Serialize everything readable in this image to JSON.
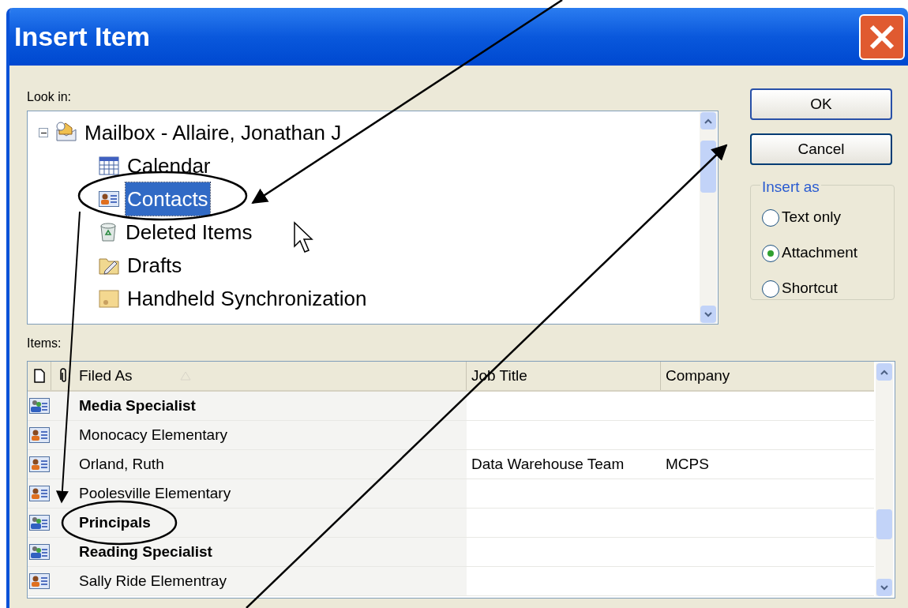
{
  "window": {
    "title": "Insert Item"
  },
  "look_in": {
    "label": "Look in:",
    "tree": {
      "label": "Mailbox - Allaire, Jonathan J",
      "expanded": true,
      "children": [
        {
          "label": "Calendar",
          "selected": false
        },
        {
          "label": "Contacts",
          "selected": true
        },
        {
          "label": "Deleted Items",
          "selected": false
        },
        {
          "label": "Drafts",
          "selected": false
        },
        {
          "label": "Handheld Synchronization",
          "selected": false
        }
      ]
    }
  },
  "buttons": [
    "OK",
    "Cancel"
  ],
  "insert_as": {
    "label": "Insert as",
    "options": [
      {
        "label": "Text only",
        "selected": false
      },
      {
        "label": "Attachment",
        "selected": true
      },
      {
        "label": "Shortcut",
        "selected": false
      }
    ]
  },
  "items": {
    "label": "Items:",
    "columns": [
      "Filed As",
      "Job Title",
      "Company"
    ],
    "rows": [
      {
        "kind": "group",
        "filed_as": "Media Specialist"
      },
      {
        "kind": "contact",
        "filed_as": "Monocacy Elementary"
      },
      {
        "kind": "contact",
        "filed_as": "Orland, Ruth",
        "job_title": "Data Warehouse Team",
        "company": "MCPS"
      },
      {
        "kind": "contact",
        "filed_as": "Poolesville Elementary"
      },
      {
        "kind": "group",
        "filed_as": "Principals"
      },
      {
        "kind": "group",
        "filed_as": "Reading Specialist"
      },
      {
        "kind": "contact",
        "filed_as": "Sally Ride Elementray"
      }
    ]
  }
}
